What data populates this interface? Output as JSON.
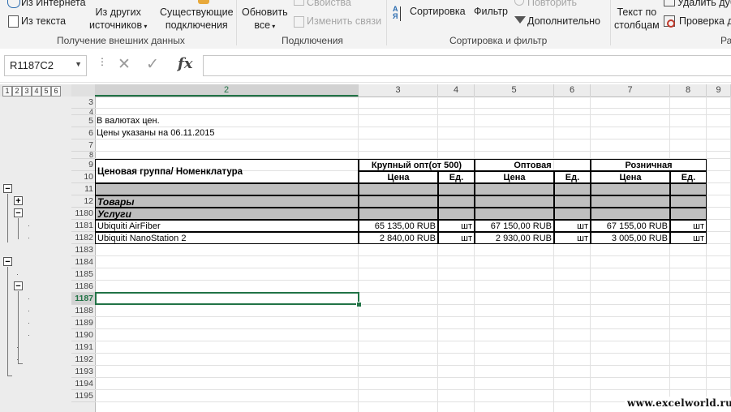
{
  "ribbon": {
    "from_web": "Из Интернета",
    "from_text": "Из текста",
    "from_other_line1": "Из других",
    "from_other_line2": "источников",
    "existing_line1": "Существующие",
    "existing_line2": "подключения",
    "group_get_external": "Получение внешних данных",
    "refresh_line1": "Обновить",
    "refresh_line2": "все",
    "properties": "Свойства",
    "edit_links": "Изменить связи",
    "group_connections": "Подключения",
    "sort": "Сортировка",
    "filter": "Фильтр",
    "reapply": "Повторить",
    "advanced": "Дополнительно",
    "group_sort_filter": "Сортировка и фильтр",
    "text_to_cols_line1": "Текст по",
    "text_to_cols_line2": "столбцам",
    "remove_dup": "Удалить дуб",
    "data_validation": "Проверка да",
    "group_partial": "Ра"
  },
  "formula_bar": {
    "name_box": "R1187C2",
    "cancel_icon": "✕",
    "enter_icon": "✓",
    "fx": "fx",
    "value": ""
  },
  "outline_levels": [
    "1",
    "2",
    "3",
    "4",
    "5",
    "6"
  ],
  "columns": [
    "2",
    "3",
    "4",
    "5",
    "6",
    "7",
    "8",
    "9"
  ],
  "rows": [
    "3",
    "4",
    "5",
    "6",
    "7",
    "8",
    "9",
    "10",
    "11",
    "12",
    "1180",
    "1181",
    "1182",
    "1183",
    "1184",
    "1185",
    "1186",
    "1187",
    "1188",
    "1189",
    "1190",
    "1191",
    "1192",
    "1193",
    "1194",
    "1195"
  ],
  "sheet": {
    "note1": "В валютах цен.",
    "note2": "Цены указаны на 06.11.2015",
    "hdr_group": "Ценовая группа/ Номенклатура",
    "hdr_bulk": "Крупный опт(от 500)",
    "hdr_wholesale": "Оптовая",
    "hdr_retail": "Розничная",
    "hdr_price": "Цена",
    "hdr_unit": "Ед.",
    "group_goods": "Товары",
    "group_services": "Услуги",
    "items": [
      {
        "name": "Ubiquiti AirFiber",
        "p1": "65 135,00 RUB",
        "u1": "шт",
        "p2": "67 150,00 RUB",
        "u2": "шт",
        "p3": "67 155,00 RUB",
        "u3": "шт"
      },
      {
        "name": "Ubiquiti NanoStation 2",
        "p1": "2 840,00 RUB",
        "u1": "шт",
        "p2": "2 930,00 RUB",
        "u2": "шт",
        "p3": "3 005,00 RUB",
        "u3": "шт"
      }
    ]
  },
  "watermark": "www.excelworld.ru",
  "colors": {
    "active_green": "#217346",
    "group_fill": "#bfbfbf"
  }
}
